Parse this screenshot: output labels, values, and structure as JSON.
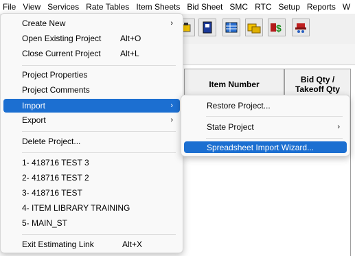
{
  "menubar": {
    "items": [
      "File",
      "View",
      "Services",
      "Rate Tables",
      "Item Sheets",
      "Bid Sheet",
      "SMC",
      "RTC",
      "Setup",
      "Reports",
      "W"
    ]
  },
  "grid": {
    "col_item_number": "Item Number",
    "col_bid_qty": "Bid Qty /\nTakeoff Qty"
  },
  "file_menu": {
    "create_new": "Create New",
    "open_existing": "Open Existing Project",
    "open_shortcut": "Alt+O",
    "close_current": "Close Current Project",
    "close_shortcut": "Alt+L",
    "properties": "Project Properties",
    "comments": "Project Comments",
    "import": "Import",
    "export": "Export",
    "delete": "Delete Project...",
    "recent": [
      "1- 418716 TEST 3",
      "2- 418716 TEST 2",
      "3- 418716 TEST",
      "4- ITEM LIBRARY TRAINING",
      "5- MAIN_ST"
    ],
    "exit": "Exit Estimating Link",
    "exit_shortcut": "Alt+X",
    "submenu_arrow": "›"
  },
  "import_menu": {
    "restore": "Restore Project...",
    "state": "State Project",
    "wizard": "Spreadsheet Import Wizard..."
  },
  "toolbar_icons": [
    "cap-icon",
    "book-icon",
    "table-icon",
    "folders-icon",
    "money-icon",
    "hat-icon"
  ]
}
